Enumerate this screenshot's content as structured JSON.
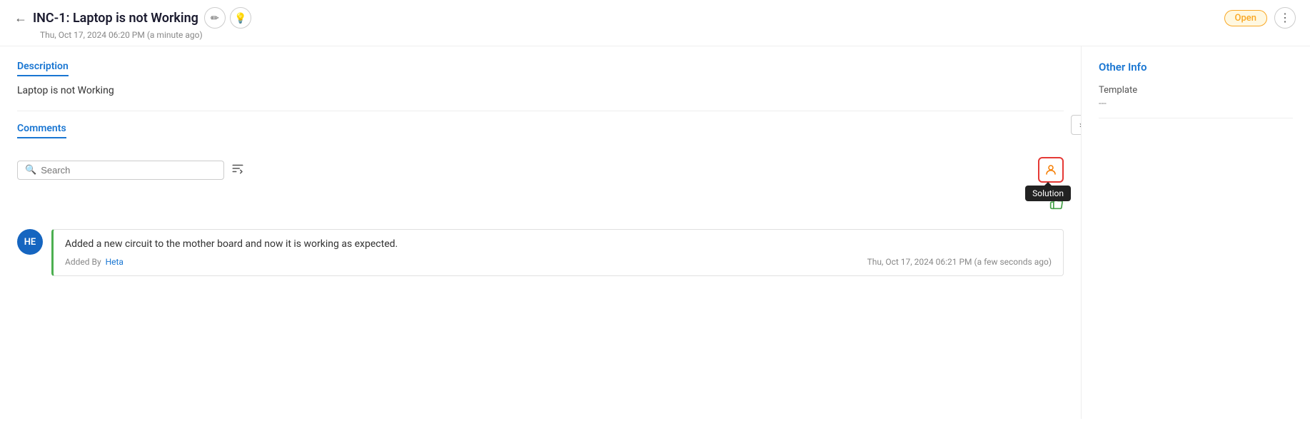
{
  "header": {
    "back_label": "←",
    "title": "INC-1: Laptop is not Working",
    "edit_icon": "✏️",
    "bulb_icon": "💡",
    "subtitle": "Thu, Oct 17, 2024 06:20 PM (a minute ago)",
    "status": "Open",
    "more_icon": "⋮"
  },
  "description": {
    "label": "Description",
    "text": "Laptop is not Working"
  },
  "comments": {
    "label": "Comments",
    "search_placeholder": "Search",
    "sort_icon": "sort",
    "solution_tooltip": "Solution",
    "items": [
      {
        "avatar_initials": "HE",
        "text": "Added a new circuit to the mother board and now it is working as expected.",
        "added_by_label": "Added By",
        "author": "Heta",
        "timestamp": "Thu, Oct 17, 2024 06:21 PM (a few seconds ago)"
      }
    ]
  },
  "other_info": {
    "title": "Other Info",
    "template_label": "Template",
    "template_value": "---"
  },
  "colors": {
    "accent_blue": "#1976d2",
    "status_badge_bg": "#fff8e1",
    "status_badge_text": "#f9a825",
    "status_badge_border": "#f9a825",
    "avatar_bg": "#1565c0",
    "comment_border": "#4caf50",
    "solution_border": "#e53935"
  }
}
